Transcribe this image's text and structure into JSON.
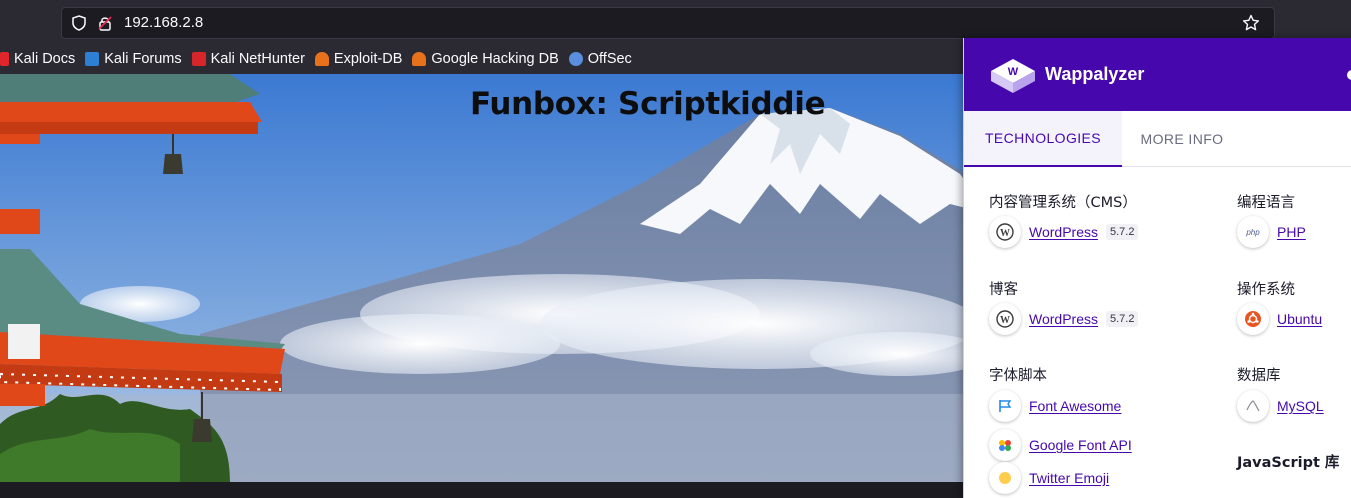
{
  "browser": {
    "url": "192.168.2.8",
    "bookmarks": [
      {
        "label": "Kali Docs",
        "icon": "kali-docs-favicon",
        "color": "#e0262a"
      },
      {
        "label": "Kali Forums",
        "icon": "kali-forums-favicon",
        "color": "#2d7fd3"
      },
      {
        "label": "Kali NetHunter",
        "icon": "kali-nethunter-favicon",
        "color": "#d7262a"
      },
      {
        "label": "Exploit-DB",
        "icon": "exploit-db-favicon",
        "color": "#e8721c"
      },
      {
        "label": "Google Hacking DB",
        "icon": "ghdb-favicon",
        "color": "#e8721c"
      },
      {
        "label": "OffSec",
        "icon": "offsec-favicon",
        "color": "#5b8ede"
      }
    ]
  },
  "page": {
    "title": "Funbox: Scriptkiddie"
  },
  "wappalyzer": {
    "brand": "Wappalyzer",
    "accent": "#4608ad",
    "tabs": {
      "technologies": "TECHNOLOGIES",
      "more_info": "MORE INFO"
    },
    "categories": {
      "cms": {
        "label": "内容管理系统（CMS）",
        "tech": {
          "name": "WordPress",
          "version": "5.7.2",
          "icon": "wordpress-icon"
        }
      },
      "blog": {
        "label": "博客",
        "tech": {
          "name": "WordPress",
          "version": "5.7.2",
          "icon": "wordpress-icon"
        }
      },
      "font_scripts": {
        "label": "字体脚本",
        "techs": [
          {
            "name": "Font Awesome",
            "icon": "font-awesome-icon"
          },
          {
            "name": "Google Font API",
            "icon": "google-font-api-icon"
          },
          {
            "name": "Twitter Emoji",
            "icon": "twitter-emoji-icon"
          }
        ]
      },
      "language": {
        "label": "编程语言",
        "tech": {
          "name": "PHP",
          "icon": "php-icon"
        }
      },
      "os": {
        "label": "操作系统",
        "tech": {
          "name": "Ubuntu",
          "icon": "ubuntu-icon"
        }
      },
      "database": {
        "label": "数据库",
        "tech": {
          "name": "MySQL",
          "icon": "mysql-icon"
        }
      },
      "js_libs": {
        "label": "JavaScript 库"
      }
    }
  }
}
